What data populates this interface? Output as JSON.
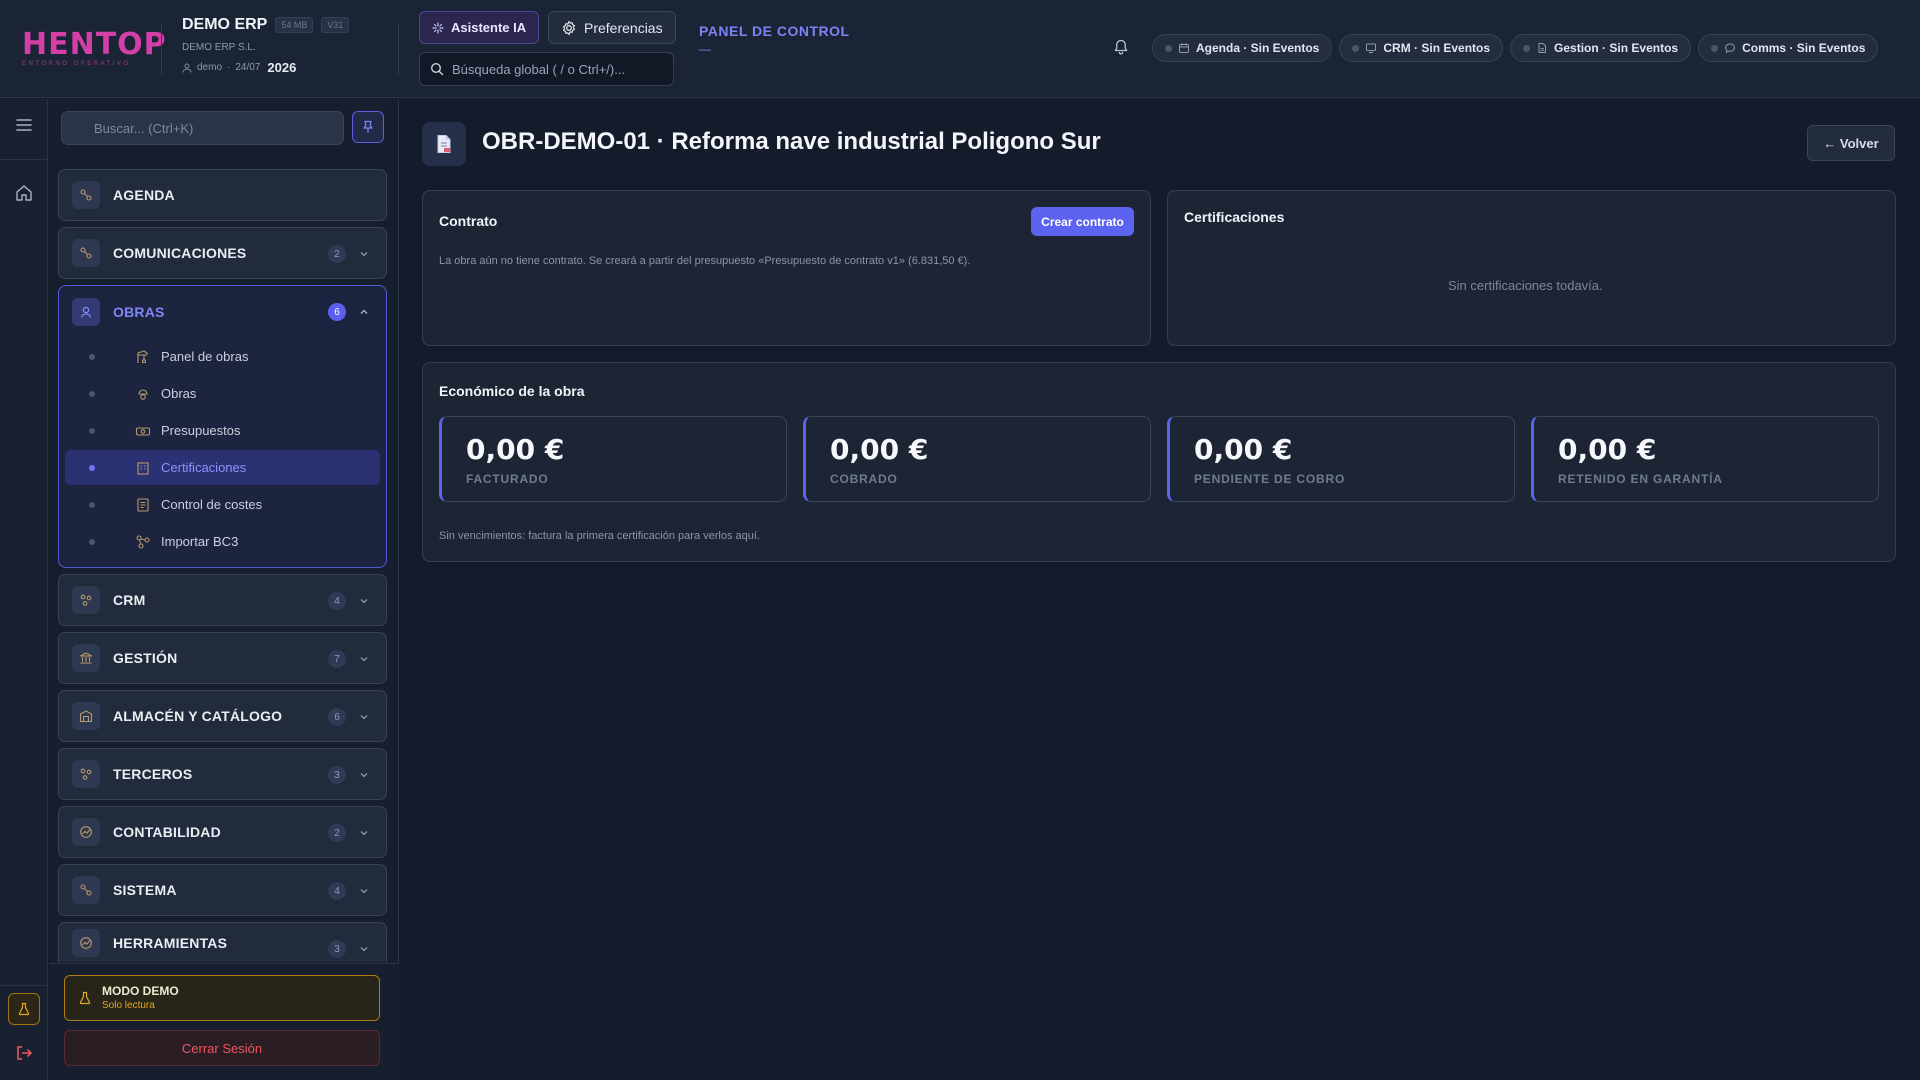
{
  "logo": {
    "text": "HENTOP",
    "subtitle": "ENTORNO OPERATIVO"
  },
  "app": {
    "title": "DEMO ERP",
    "size_badge": "54 MB",
    "version_badge": "V31",
    "company": "DEMO ERP S.L.",
    "user": "demo",
    "date": "24/07",
    "year": "2026"
  },
  "header": {
    "ai_button": "Asistente IA",
    "preferences_button": "Preferencias",
    "global_search_placeholder": "Búsqueda global ( / o Ctrl+/)...",
    "panel_title": "PANEL DE CONTROL",
    "panel_sub": "—",
    "pills": [
      {
        "label": "Agenda · Sin Eventos",
        "icon": "calendar-icon"
      },
      {
        "label": "CRM · Sin Eventos",
        "icon": "monitor-icon"
      },
      {
        "label": "Gestion · Sin Eventos",
        "icon": "document-icon"
      },
      {
        "label": "Comms · Sin Eventos",
        "icon": "chat-icon"
      }
    ]
  },
  "sidebar": {
    "search_placeholder": "Buscar... (Ctrl+K)",
    "sections": [
      {
        "label": "AGENDA",
        "count": ""
      },
      {
        "label": "COMUNICACIONES",
        "count": "2"
      },
      {
        "label": "OBRAS",
        "count": "6",
        "expanded": true
      },
      {
        "label": "CRM",
        "count": "4"
      },
      {
        "label": "GESTIÓN",
        "count": "7"
      },
      {
        "label": "ALMACÉN Y CATÁLOGO",
        "count": "6"
      },
      {
        "label": "TERCEROS",
        "count": "3"
      },
      {
        "label": "CONTABILIDAD",
        "count": "2"
      },
      {
        "label": "SISTEMA",
        "count": "4"
      },
      {
        "label": "HERRAMIENTAS",
        "count": "3"
      }
    ],
    "obras_items": [
      {
        "label": "Panel de obras"
      },
      {
        "label": "Obras"
      },
      {
        "label": "Presupuestos"
      },
      {
        "label": "Certificaciones",
        "active": true
      },
      {
        "label": "Control de costes"
      },
      {
        "label": "Importar BC3"
      }
    ],
    "demo_title": "MODO DEMO",
    "demo_sub": "Solo lectura",
    "logout": "Cerrar Sesión"
  },
  "main": {
    "title": "OBR-DEMO-01 · Reforma nave industrial Poligono Sur",
    "back_button": "← Volver",
    "contract": {
      "title": "Contrato",
      "create_button": "Crear contrato",
      "text": "La obra aún no tiene contrato. Se creará a partir del presupuesto «Presupuesto de contrato v1» (6.831,50 €)."
    },
    "certifications": {
      "title": "Certificaciones",
      "empty": "Sin certificaciones todavía."
    },
    "economic": {
      "title": "Económico de la obra",
      "metrics": [
        {
          "value": "0,00 €",
          "label": "FACTURADO"
        },
        {
          "value": "0,00 €",
          "label": "COBRADO"
        },
        {
          "value": "0,00 €",
          "label": "PENDIENTE DE COBRO"
        },
        {
          "value": "0,00 €",
          "label": "RETENIDO EN GARANTÍA"
        }
      ],
      "note": "Sin vencimientos: factura la primera certificación para verlos aquí."
    }
  },
  "colors": {
    "accent": "#5b63f0",
    "brand": "#d43fa7",
    "demo": "#e6a823",
    "danger": "#f0555f"
  }
}
